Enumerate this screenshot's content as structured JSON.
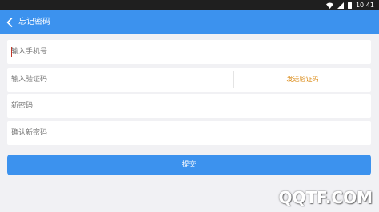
{
  "status_bar": {
    "time": "10:41",
    "icons": [
      "wifi-icon",
      "signal-icon",
      "battery-icon"
    ]
  },
  "header": {
    "back_icon": "chevron-left-icon",
    "title": "忘记密码"
  },
  "form": {
    "phone": {
      "value": "",
      "placeholder": "输入手机号"
    },
    "code": {
      "value": "",
      "placeholder": "输入验证码",
      "send_label": "发送验证码"
    },
    "new_password": {
      "value": "",
      "placeholder": "新密码"
    },
    "confirm_password": {
      "value": "",
      "placeholder": "确认新密码"
    },
    "submit_label": "提交"
  },
  "watermark": "QQTF.COM",
  "colors": {
    "primary": "#3c92ee",
    "background": "#f1f1f4",
    "send_code": "#d9850c",
    "status_bar": "#1f1f1f"
  }
}
